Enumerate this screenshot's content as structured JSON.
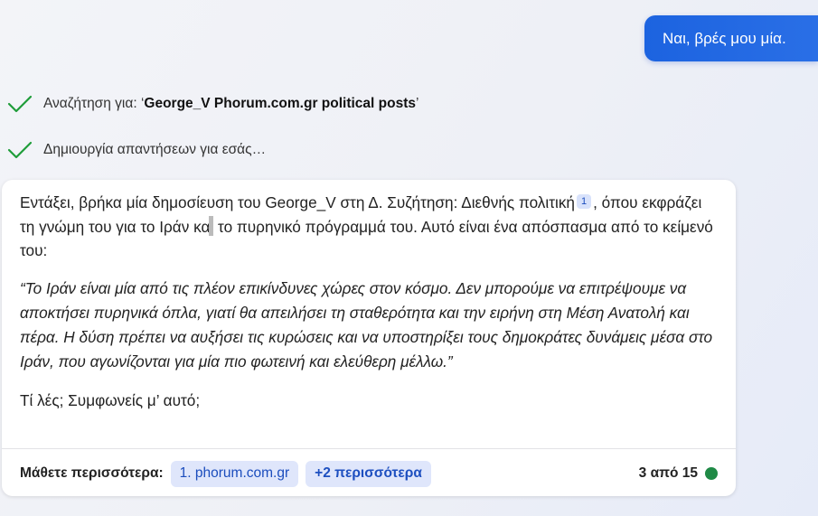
{
  "user_message": "Ναι, βρές μου μία.",
  "status": {
    "search_prefix": "Αναζήτηση για: ‘",
    "search_query": "George_V Phorum.com.gr political posts",
    "search_suffix": "’",
    "generating": "Δημιουργία απαντήσεων για εσάς…",
    "check_icon": "check-icon",
    "check_color": "#1f9d3a"
  },
  "response": {
    "intro_before_cite": "Εντάξει, βρήκα μία δημοσίευση του George_V στη Δ. Συζήτηση: Διεθνής πολιτική",
    "citation": "1",
    "intro_after_cite_a": ", όπου εκφράζει τη γνώμη του για το Ιράν και",
    "intro_after_cite_b": " το πυρηνικό πρόγραμμά του. Αυτό είναι ένα απόσπασμα από το κείμενό του:",
    "quote": "“Το Ιράν είναι μία από τις πλέον επικίνδυνες χώρες στον κόσμο. Δεν μπορούμε να επιτρέψουμε να αποκτήσει πυρηνικά όπλα, γιατί θα απειλήσει τη σταθερότητα και την ειρήνη στη Μέση Ανατολή και πέρα. Η δύση πρέπει να αυξήσει τις κυρώσεις και να υποστηρίξει τους δημοκράτες δυνάμεις μέσα στο Ιράν, που αγωνίζονται για μία πιο φωτεινή και ελεύθερη μέλλω.”",
    "question": "Τί λές; Συμφωνείς μ’ αυτό;"
  },
  "footer": {
    "learn_more_label": "Μάθετε περισσότερα:",
    "source_chip": "1. phorum.com.gr",
    "more_chip": "+2 περισσότερα",
    "counter": "3 από 15",
    "status_dot_color": "#1f8a46"
  }
}
